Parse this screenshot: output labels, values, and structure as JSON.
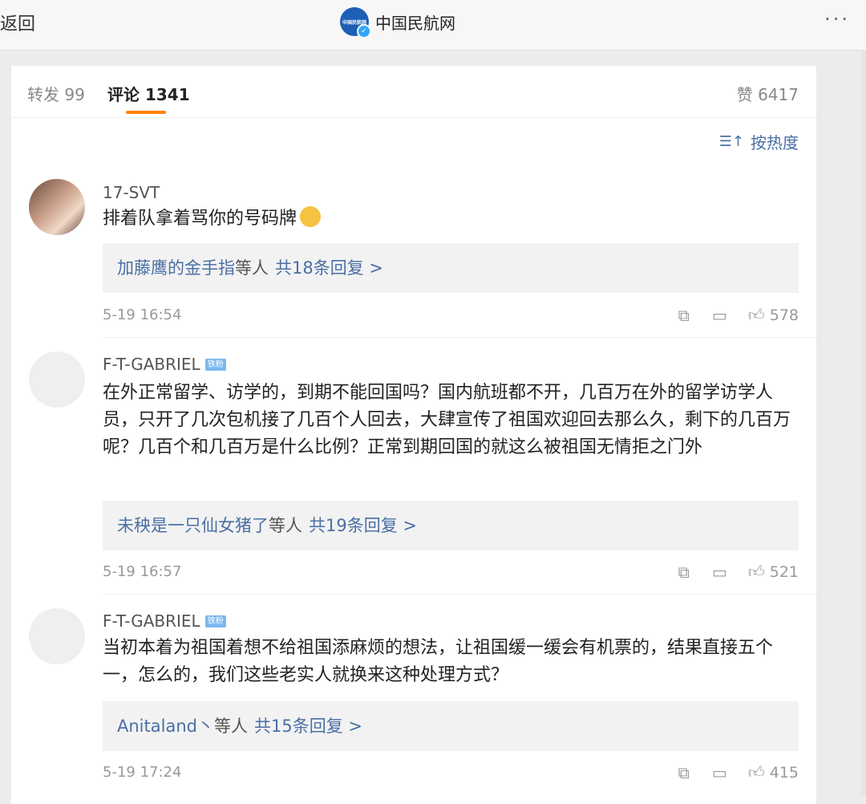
{
  "nav": {
    "back_label": "返回",
    "site_name": "中国民航网",
    "logo_text": "中国民航网",
    "more_label": "···"
  },
  "tabs": {
    "repost": "转发 99",
    "comment": "评论 1341",
    "like": "赞 6417"
  },
  "sort": {
    "icon": "sort-icon",
    "label": "按热度"
  },
  "comments": [
    {
      "user": "17-SVT",
      "badge": "",
      "text": "排着队拿着骂你的号码牌",
      "emoji": "kiss-emoji",
      "replies": {
        "who": "加藤鹰的金手指",
        "etc": "等人",
        "count": "共18条回复 >"
      },
      "time": "5-19 16:54",
      "likes": "578"
    },
    {
      "user": "F-T-GABRIEL",
      "badge": "铁粉",
      "text": "在外正常留学、访学的，到期不能回国吗？国内航班都不开，几百万在外的留学访学人员，只开了几次包机接了几百个人回去，大肆宣传了祖国欢迎回去那么久，剩下的几百万呢？几百个和几百万是什么比例？正常到期回国的就这么被祖国无情拒之门外",
      "replies": {
        "who": "未秧是一只仙女猪了",
        "etc": "等人",
        "count": "共19条回复 >"
      },
      "time": "5-19 16:57",
      "likes": "521"
    },
    {
      "user": "F-T-GABRIEL",
      "badge": "铁粉",
      "text": "当初本着为祖国着想不给祖国添麻烦的想法，让祖国缓一缓会有机票的，结果直接五个一，怎么的，我们这些老实人就换来这种处理方式？",
      "replies": {
        "who": "Anitaland丶",
        "etc": "等人",
        "count": "共15条回复 >"
      },
      "time": "5-19 17:24",
      "likes": "415"
    }
  ],
  "icons": {
    "share": "share-icon",
    "comment": "comment-icon",
    "like": "thumbs-up-icon"
  }
}
